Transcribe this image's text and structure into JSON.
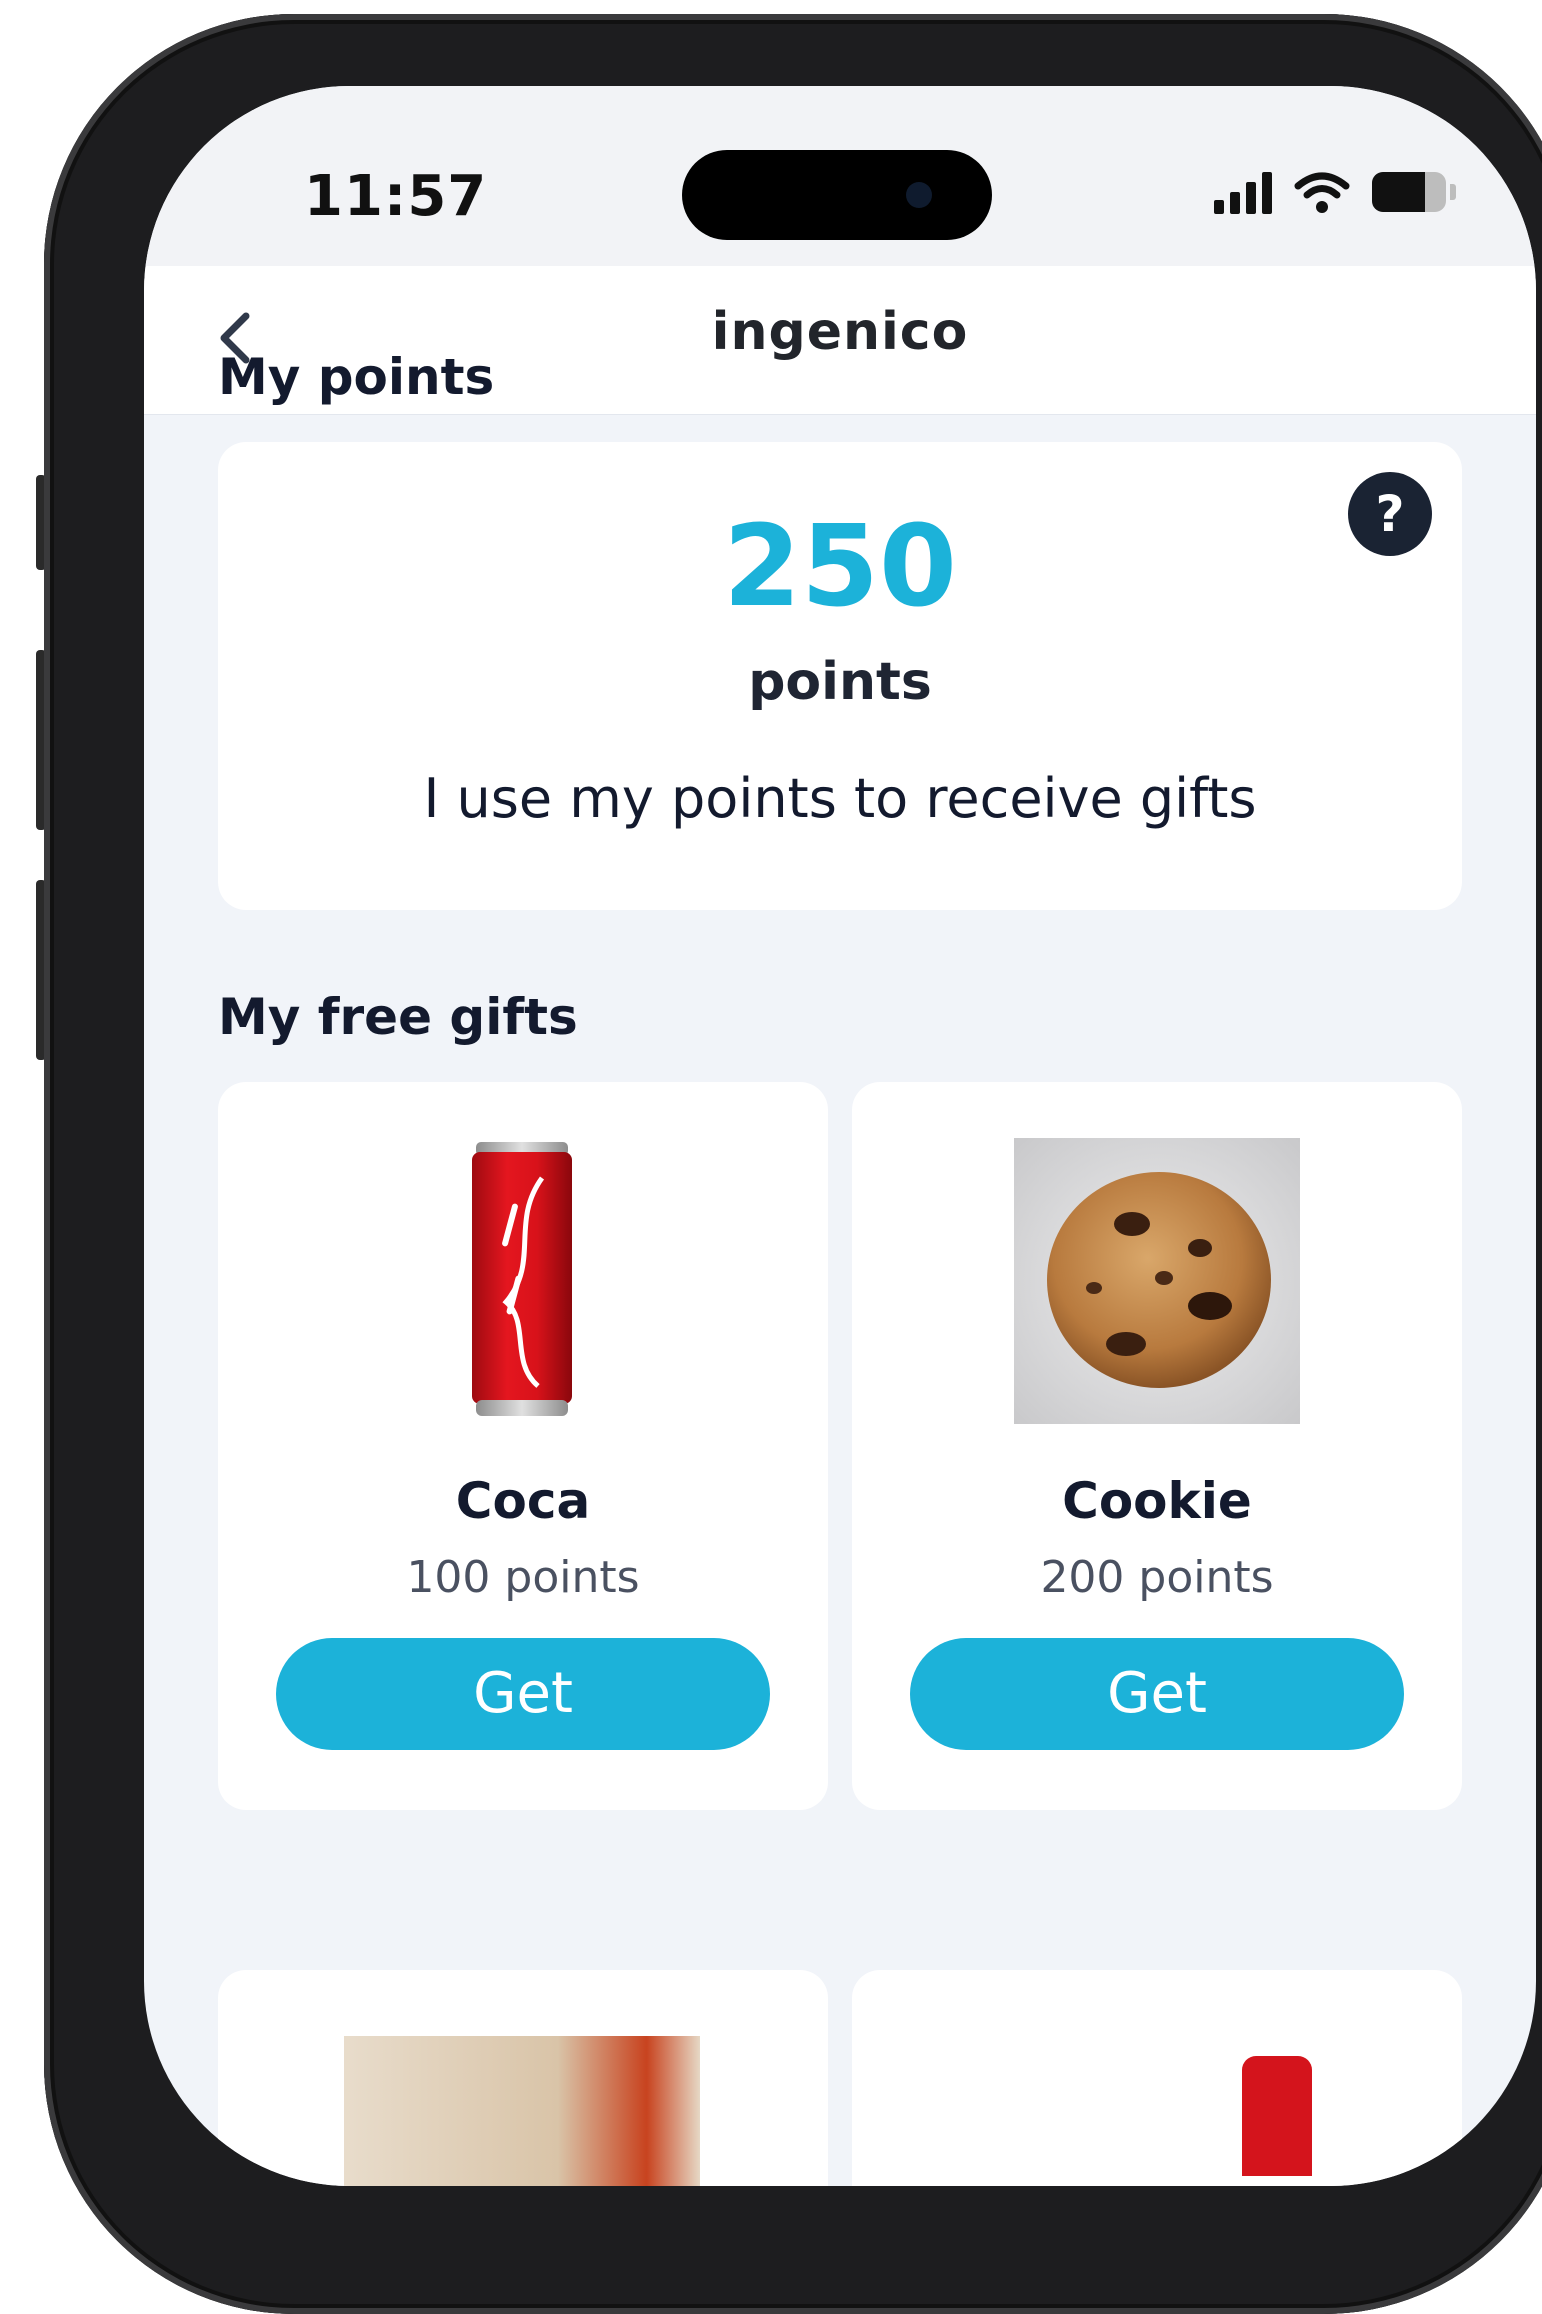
{
  "status_bar": {
    "time": "11:57",
    "icons": [
      "signal-icon",
      "wifi-icon",
      "battery-icon"
    ],
    "battery_level": 0.72
  },
  "header": {
    "back_icon": "chevron-left-icon",
    "logo_text": "ingenico"
  },
  "points_section": {
    "title": "My points",
    "help_label": "?",
    "value": "250",
    "unit": "points",
    "description": "I use my points to receive gifts"
  },
  "gifts_section": {
    "title": "My free gifts",
    "items": [
      {
        "name": "Coca",
        "points": "100 points",
        "button": "Get",
        "image": "coca-cola-can-image"
      },
      {
        "name": "Cookie",
        "points": "200 points",
        "button": "Get",
        "image": "cookie-image"
      }
    ]
  },
  "colors": {
    "accent": "#1cb2d9",
    "text_dark": "#131a2e",
    "background": "#f1f4f9",
    "card": "#ffffff"
  }
}
